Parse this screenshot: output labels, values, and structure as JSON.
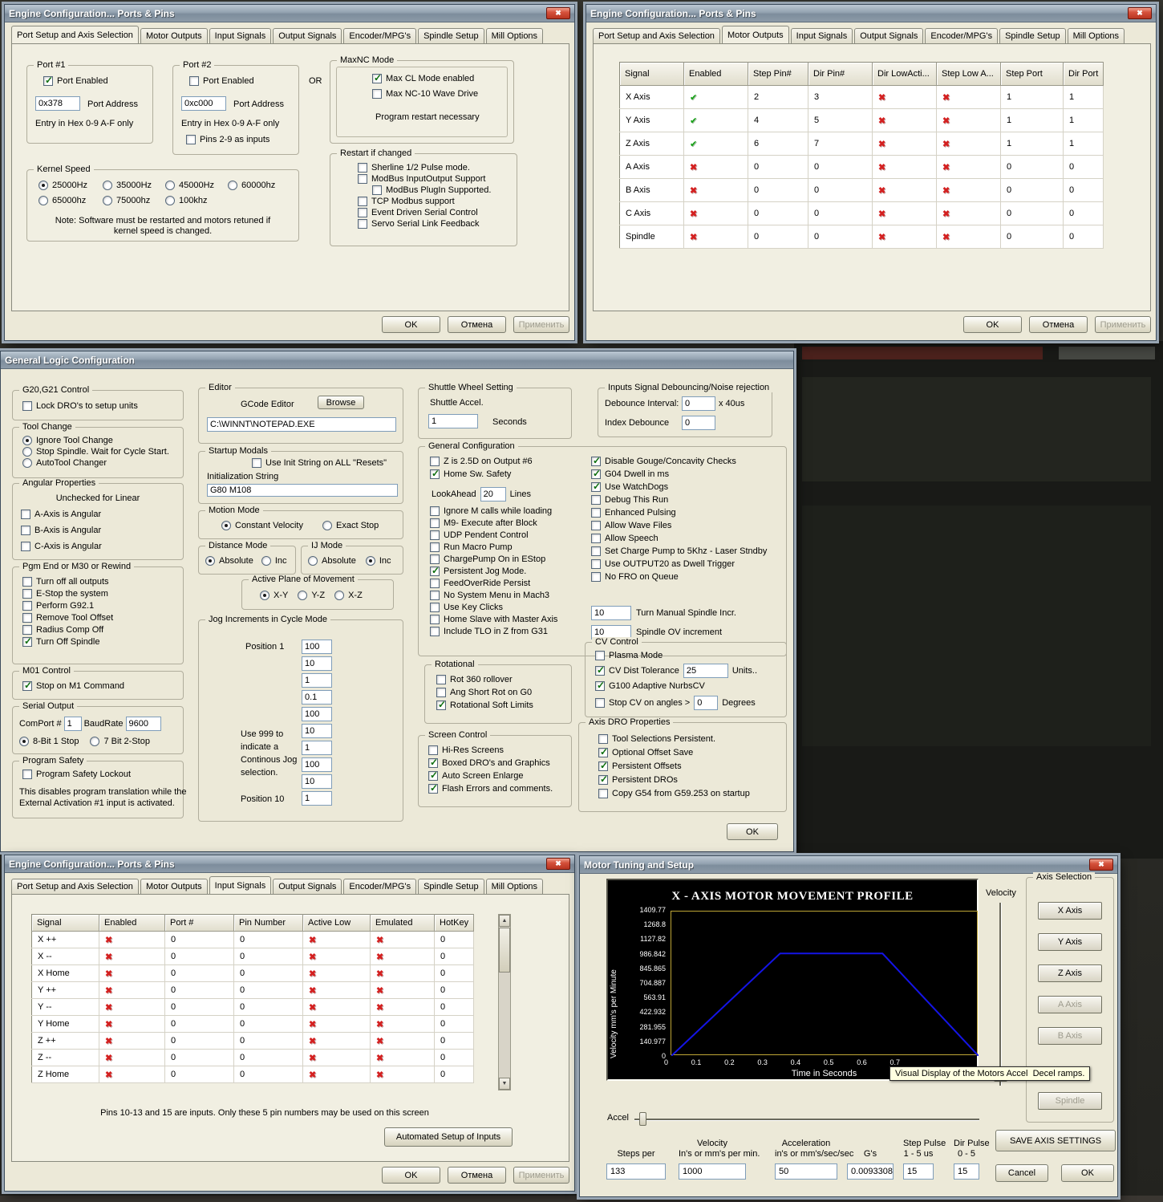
{
  "buttons": {
    "ok": "OK",
    "cancel": "Отмена",
    "apply": "Применить"
  },
  "close_glyph": "✖",
  "engine_title": "Engine Configuration... Ports & Pins",
  "d1": {
    "tabs": [
      {
        "label": "Port Setup and Axis Selection",
        "active": true
      },
      {
        "label": "Motor Outputs"
      },
      {
        "label": "Input Signals"
      },
      {
        "label": "Output Signals"
      },
      {
        "label": "Encoder/MPG's"
      },
      {
        "label": "Spindle Setup"
      },
      {
        "label": "Mill Options"
      }
    ],
    "port1": {
      "legend": "Port #1",
      "enabled_label": "Port Enabled",
      "enabled_checked": true,
      "address": "0x378",
      "address_label": "Port Address",
      "hint": "Entry in Hex 0-9 A-F only"
    },
    "port2": {
      "legend": "Port #2",
      "enabled_label": "Port Enabled",
      "enabled_checked": false,
      "address": "0xc000",
      "address_label": "Port Address",
      "hint": "Entry in Hex 0-9 A-F only",
      "pins_label": "Pins 2-9 as inputs",
      "pins_checked": false
    },
    "or_label": "OR",
    "maxnc": {
      "legend": "MaxNC Mode",
      "items": [
        {
          "label": "Max CL Mode enabled",
          "checked": true
        },
        {
          "label": "Max NC-10 Wave Drive"
        }
      ],
      "note": "Program restart necessary"
    },
    "restart": {
      "legend": "Restart if changed",
      "items": [
        {
          "label": "Sherline 1/2 Pulse mode."
        },
        {
          "label": "ModBus InputOutput Support"
        },
        {
          "label": "ModBus PlugIn Supported.",
          "indent": true
        },
        {
          "label": "TCP Modbus support"
        },
        {
          "label": "Event Driven Serial Control"
        },
        {
          "label": "Servo Serial Link Feedback"
        }
      ]
    },
    "kernel": {
      "legend": "Kernel Speed",
      "options": [
        {
          "label": "25000Hz",
          "on": true
        },
        {
          "label": "35000Hz"
        },
        {
          "label": "45000Hz"
        },
        {
          "label": "60000hz"
        },
        {
          "label": "65000hz"
        },
        {
          "label": "75000hz"
        },
        {
          "label": "100khz"
        }
      ],
      "note1": "Note: Software must be restarted and motors retuned if",
      "note2": "kernel speed is changed."
    }
  },
  "d2": {
    "tabs": [
      {
        "label": "Port Setup and Axis Selection"
      },
      {
        "label": "Motor Outputs",
        "active": true
      },
      {
        "label": "Input Signals"
      },
      {
        "label": "Output Signals"
      },
      {
        "label": "Encoder/MPG's"
      },
      {
        "label": "Spindle Setup"
      },
      {
        "label": "Mill Options"
      }
    ],
    "headers": [
      "Signal",
      "Enabled",
      "Step Pin#",
      "Dir Pin#",
      "Dir LowActi...",
      "Step Low A...",
      "Step Port",
      "Dir Port"
    ],
    "rows": [
      {
        "signal": "X Axis",
        "enabled": "check",
        "step_pin": "2",
        "dir_pin": "3",
        "dir_low": "cross",
        "step_low": "cross",
        "step_port": "1",
        "dir_port": "1"
      },
      {
        "signal": "Y Axis",
        "enabled": "check",
        "step_pin": "4",
        "dir_pin": "5",
        "dir_low": "cross",
        "step_low": "cross",
        "step_port": "1",
        "dir_port": "1"
      },
      {
        "signal": "Z Axis",
        "enabled": "check",
        "step_pin": "6",
        "dir_pin": "7",
        "dir_low": "cross",
        "step_low": "cross",
        "step_port": "1",
        "dir_port": "1"
      },
      {
        "signal": "A Axis",
        "enabled": "cross",
        "step_pin": "0",
        "dir_pin": "0",
        "dir_low": "cross",
        "step_low": "cross",
        "step_port": "0",
        "dir_port": "0"
      },
      {
        "signal": "B Axis",
        "enabled": "cross",
        "step_pin": "0",
        "dir_pin": "0",
        "dir_low": "cross",
        "step_low": "cross",
        "step_port": "0",
        "dir_port": "0"
      },
      {
        "signal": "C Axis",
        "enabled": "cross",
        "step_pin": "0",
        "dir_pin": "0",
        "dir_low": "cross",
        "step_low": "cross",
        "step_port": "0",
        "dir_port": "0"
      },
      {
        "signal": "Spindle",
        "enabled": "cross",
        "step_pin": "0",
        "dir_pin": "0",
        "dir_low": "cross",
        "step_low": "cross",
        "step_port": "0",
        "dir_port": "0"
      }
    ]
  },
  "d3": {
    "title": "General Logic Configuration",
    "g20": {
      "legend": "G20,G21 Control",
      "label": "Lock DRO's to setup units",
      "checked": false
    },
    "toolchange": {
      "legend": "Tool Change",
      "options": [
        {
          "label": "Ignore Tool Change",
          "on": true
        },
        {
          "label": "Stop Spindle. Wait for Cycle Start."
        },
        {
          "label": "AutoTool Changer"
        }
      ]
    },
    "angular": {
      "legend": "Angular Properties",
      "note": "Unchecked for Linear",
      "items": [
        {
          "label": "A-Axis is Angular"
        },
        {
          "label": "B-Axis is Angular"
        },
        {
          "label": "C-Axis is Angular"
        }
      ]
    },
    "pgmend": {
      "legend": "Pgm End or M30 or Rewind",
      "items": [
        {
          "label": "Turn off all outputs"
        },
        {
          "label": "E-Stop the system"
        },
        {
          "label": "Perform G92.1"
        },
        {
          "label": "Remove Tool Offset"
        },
        {
          "label": "Radius Comp Off"
        },
        {
          "label": "Turn Off Spindle",
          "checked": true
        }
      ]
    },
    "m01": {
      "legend": "M01 Control",
      "label": "Stop on M1 Command",
      "checked": true
    },
    "serial": {
      "legend": "Serial Output",
      "comport_label": "ComPort #",
      "comport": "1",
      "baud_label": "BaudRate",
      "baud": "9600",
      "options": [
        {
          "label": "8-Bit 1 Stop",
          "on": true
        },
        {
          "label": "7 Bit 2-Stop"
        }
      ]
    },
    "safety": {
      "legend": "Program Safety",
      "label": "Program Safety Lockout",
      "checked": false,
      "note1": "This disables program translation while the",
      "note2": "External Activation #1 input is activated."
    },
    "editor": {
      "legend": "Editor",
      "label": "GCode Editor",
      "browse": "Browse",
      "path": "C:\\WINNT\\NOTEPAD.EXE"
    },
    "startup": {
      "legend": "Startup Modals",
      "init_label": "Use Init String on ALL  \"Resets\"",
      "init_checked": false,
      "string_label": "Initialization String",
      "string_value": "G80 M108"
    },
    "motion": {
      "legend": "Motion Mode",
      "options": [
        {
          "label": "Constant Velocity",
          "on": true
        },
        {
          "label": "Exact Stop"
        }
      ]
    },
    "distance": {
      "legend": "Distance Mode",
      "options": [
        {
          "label": "Absolute",
          "on": true
        },
        {
          "label": "Inc"
        }
      ]
    },
    "ij": {
      "legend": "IJ Mode",
      "options": [
        {
          "label": "Absolute"
        },
        {
          "label": "Inc",
          "on": true
        }
      ]
    },
    "plane": {
      "legend": "Active Plane of Movement",
      "options": [
        {
          "label": "X-Y",
          "on": true
        },
        {
          "label": "Y-Z"
        },
        {
          "label": "X-Z"
        }
      ]
    },
    "jog": {
      "legend": "Jog Increments in Cycle Mode",
      "pos1_label": "Position 1",
      "values": [
        "100",
        "10",
        "1",
        "0.1",
        "100",
        "10",
        "1",
        "100",
        "10"
      ],
      "use999": [
        "Use 999 to",
        "indicate a",
        "Continous Jog",
        "selection."
      ],
      "pos10_label": "Position 10",
      "pos10_value": "1"
    },
    "shuttle": {
      "legend": "Shuttle Wheel Setting",
      "label": "Shuttle Accel.",
      "value": "1",
      "units": "Seconds"
    },
    "debounce": {
      "legend": "Inputs Signal Debouncing/Noise rejection",
      "interval_label": "Debounce Interval:",
      "interval": "0",
      "interval_units": "x 40us",
      "index_label": "Index Debounce",
      "index": "0"
    },
    "genconf": {
      "legend": "General Configuration",
      "left_top": [
        {
          "label": "Z is 2.5D on Output #6"
        },
        {
          "label": "Home Sw. Safety",
          "checked": true
        }
      ],
      "lookahead_label": "LookAhead",
      "lookahead": "20",
      "lookahead_units": "Lines",
      "left_rest": [
        {
          "label": "Ignore M calls while loading"
        },
        {
          "label": "M9- Execute after Block"
        },
        {
          "label": "UDP Pendent Control"
        },
        {
          "label": "Run Macro Pump"
        },
        {
          "label": "ChargePump On in EStop"
        },
        {
          "label": "Persistent Jog Mode.",
          "checked": true
        },
        {
          "label": "FeedOverRide Persist"
        },
        {
          "label": "No System Menu in Mach3"
        },
        {
          "label": "Use Key Clicks"
        },
        {
          "label": "Home Slave with Master Axis"
        },
        {
          "label": "Include TLO in Z from G31"
        }
      ],
      "right": [
        {
          "label": "Disable Gouge/Concavity Checks",
          "checked": true
        },
        {
          "label": "G04 Dwell in ms",
          "checked": true
        },
        {
          "label": "Use WatchDogs",
          "checked": true
        },
        {
          "label": "Debug This Run"
        },
        {
          "label": "Enhanced Pulsing"
        },
        {
          "label": "Allow Wave Files"
        },
        {
          "label": "Allow Speech"
        },
        {
          "label": "Set Charge Pump to 5Khz - Laser Stndby"
        },
        {
          "label": "Use OUTPUT20 as Dwell Trigger"
        },
        {
          "label": "No FRO on Queue"
        }
      ],
      "incr_value": "10",
      "incr_label": "Turn Manual Spindle Incr.",
      "ov_value": "10",
      "ov_label": "Spindle OV increment"
    },
    "rotational": {
      "legend": "Rotational",
      "items": [
        {
          "label": "Rot 360 rollover"
        },
        {
          "label": "Ang Short Rot on G0"
        },
        {
          "label": "Rotational Soft Limits",
          "checked": true
        }
      ]
    },
    "screen": {
      "legend": "Screen Control",
      "items": [
        {
          "label": "Hi-Res Screens"
        },
        {
          "label": "Boxed DRO's and Graphics",
          "checked": true
        },
        {
          "label": "Auto Screen Enlarge",
          "checked": true
        },
        {
          "label": "Flash Errors and comments.",
          "checked": true
        }
      ]
    },
    "cv": {
      "legend": "CV Control",
      "plasma_label": "Plasma Mode",
      "plasma_checked": false,
      "dist_label": "CV Dist Tolerance",
      "dist_checked": true,
      "dist_value": "25",
      "dist_units": "Units..",
      "nurbs_label": "G100 Adaptive NurbsCV",
      "nurbs_checked": true,
      "stop_label": "Stop CV on angles >",
      "stop_checked": false,
      "stop_value": "0",
      "stop_units": "Degrees"
    },
    "dro": {
      "legend": "Axis DRO Properties",
      "items": [
        {
          "label": "Tool Selections Persistent."
        },
        {
          "label": "Optional Offset Save",
          "checked": true
        },
        {
          "label": "Persistent Offsets",
          "checked": true
        },
        {
          "label": "Persistent DROs",
          "checked": true
        },
        {
          "label": "Copy G54 from G59.253 on startup"
        }
      ]
    }
  },
  "d4": {
    "tabs": [
      {
        "label": "Port Setup and Axis Selection"
      },
      {
        "label": "Motor Outputs"
      },
      {
        "label": "Input Signals",
        "active": true
      },
      {
        "label": "Output Signals"
      },
      {
        "label": "Encoder/MPG's"
      },
      {
        "label": "Spindle Setup"
      },
      {
        "label": "Mill Options"
      }
    ],
    "headers": [
      "Signal",
      "Enabled",
      "Port #",
      "Pin Number",
      "Active Low",
      "Emulated",
      "HotKey"
    ],
    "rows": [
      {
        "signal": "X ++",
        "enabled": "cross",
        "port": "0",
        "pin": "0",
        "active_low": "cross",
        "emulated": "cross",
        "hotkey": "0"
      },
      {
        "signal": "X --",
        "enabled": "cross",
        "port": "0",
        "pin": "0",
        "active_low": "cross",
        "emulated": "cross",
        "hotkey": "0"
      },
      {
        "signal": "X Home",
        "enabled": "cross",
        "port": "0",
        "pin": "0",
        "active_low": "cross",
        "emulated": "cross",
        "hotkey": "0"
      },
      {
        "signal": "Y ++",
        "enabled": "cross",
        "port": "0",
        "pin": "0",
        "active_low": "cross",
        "emulated": "cross",
        "hotkey": "0"
      },
      {
        "signal": "Y --",
        "enabled": "cross",
        "port": "0",
        "pin": "0",
        "active_low": "cross",
        "emulated": "cross",
        "hotkey": "0"
      },
      {
        "signal": "Y Home",
        "enabled": "cross",
        "port": "0",
        "pin": "0",
        "active_low": "cross",
        "emulated": "cross",
        "hotkey": "0"
      },
      {
        "signal": "Z ++",
        "enabled": "cross",
        "port": "0",
        "pin": "0",
        "active_low": "cross",
        "emulated": "cross",
        "hotkey": "0"
      },
      {
        "signal": "Z --",
        "enabled": "cross",
        "port": "0",
        "pin": "0",
        "active_low": "cross",
        "emulated": "cross",
        "hotkey": "0"
      },
      {
        "signal": "Z Home",
        "enabled": "cross",
        "port": "0",
        "pin": "0",
        "active_low": "cross",
        "emulated": "cross",
        "hotkey": "0"
      }
    ],
    "note": "Pins 10-13 and 15 are inputs. Only these 5 pin numbers may be used on this screen",
    "auto_button": "Automated Setup of Inputs"
  },
  "d5": {
    "title": "Motor Tuning and Setup",
    "axis_selection": {
      "legend": "Axis Selection",
      "buttons": [
        {
          "label": "X Axis"
        },
        {
          "label": "Y Axis"
        },
        {
          "label": "Z Axis"
        },
        {
          "label": "A Axis",
          "disabled": true
        },
        {
          "label": "B Axis",
          "disabled": true
        },
        {
          "label": "Spindle",
          "disabled": true,
          "gap": true
        }
      ]
    },
    "velocity_label": "Velocity",
    "accel_label": "Accel",
    "tooltip": "Visual Display of the Motors Accel  Decel ramps.",
    "chart": {
      "type": "line",
      "title": "X - AXIS MOTOR MOVEMENT PROFILE",
      "ylabel": "Velocity mm's per Minute",
      "xlabel": "Time in Seconds",
      "y_ticks": [
        "1409.77",
        "1268.8",
        "1127.82",
        "986.842",
        "845.865",
        "704.887",
        "563.91",
        "422.932",
        "281.955",
        "140.977",
        "0"
      ],
      "x_ticks": [
        "0",
        "0.1",
        "0.2",
        "0.3",
        "0.4",
        "0.5",
        "0.6",
        "0.7"
      ],
      "ymax": 1409.77,
      "xmax": 0.96,
      "line_color": "#1414e6",
      "points": [
        [
          0,
          0
        ],
        [
          0.34,
          1000
        ],
        [
          0.66,
          1000
        ],
        [
          0.96,
          0
        ]
      ]
    },
    "fields": {
      "steps": {
        "l1": "",
        "l2": "Steps per",
        "value": "133"
      },
      "vel": {
        "l1": "Velocity",
        "l2": "In's or mm's per min.",
        "value": "1000"
      },
      "acc": {
        "l1": "Acceleration",
        "l2": "in's or mm's/sec/sec",
        "value": "50"
      },
      "gs": {
        "l1": "",
        "l2": "G's",
        "value": "0.0093308"
      },
      "step_pulse": {
        "l1": "Step Pulse",
        "l2": "1 - 5 us",
        "value": "15"
      },
      "dir_pulse": {
        "l1": "Dir Pulse",
        "l2": "0 - 5",
        "value": "15"
      }
    },
    "save_button": "SAVE AXIS SETTINGS",
    "cancel_button": "Cancel",
    "ok_button": "OK"
  }
}
